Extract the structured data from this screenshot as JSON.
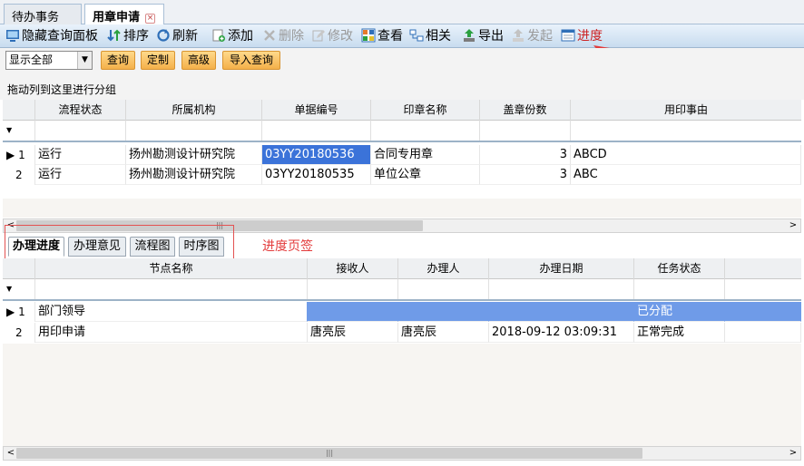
{
  "tabs": [
    {
      "label": "待办事务"
    },
    {
      "label": "用章申请"
    }
  ],
  "toolbar": {
    "hide_panel": "隐藏查询面板",
    "sort": "排序",
    "refresh": "刷新",
    "add": "添加",
    "delete": "删除",
    "edit": "修改",
    "view": "查看",
    "related": "相关",
    "export": "导出",
    "start": "发起",
    "progress": "进度"
  },
  "filter": {
    "display_select": "显示全部",
    "query": "查询",
    "customize": "定制",
    "advanced": "高级",
    "import_query": "导入查询"
  },
  "group_hint": "拖动列到这里进行分组",
  "main_grid": {
    "columns": [
      "流程状态",
      "所属机构",
      "单据编号",
      "印章名称",
      "盖章份数",
      "用印事由"
    ],
    "rows": [
      {
        "index": "1",
        "status": "运行",
        "org": "扬州勘测设计研究院",
        "doc_no": "03YY20180536",
        "seal": "合同专用章",
        "copies": "3",
        "reason": "ABCD"
      },
      {
        "index": "2",
        "status": "运行",
        "org": "扬州勘测设计研究院",
        "doc_no": "03YY20180535",
        "seal": "单位公章",
        "copies": "3",
        "reason": "ABC"
      }
    ]
  },
  "detail_tabs": [
    "办理进度",
    "办理意见",
    "流程图",
    "时序图"
  ],
  "detail_grid": {
    "columns": [
      "节点名称",
      "接收人",
      "办理人",
      "办理日期",
      "任务状态"
    ],
    "rows": [
      {
        "index": "1",
        "node": "部门领导",
        "receiver": "",
        "handler": "",
        "date": "",
        "state": "已分配"
      },
      {
        "index": "2",
        "node": "用印申请",
        "receiver": "唐亮辰",
        "handler": "唐亮辰",
        "date": "2018-09-12 03:09:31",
        "state": "正常完成"
      }
    ]
  },
  "annotation": "进度页签",
  "colors": {
    "highlight_red": "#e33b3b",
    "selection_blue": "#3b73d9",
    "button_orange": "#f4b04a"
  }
}
